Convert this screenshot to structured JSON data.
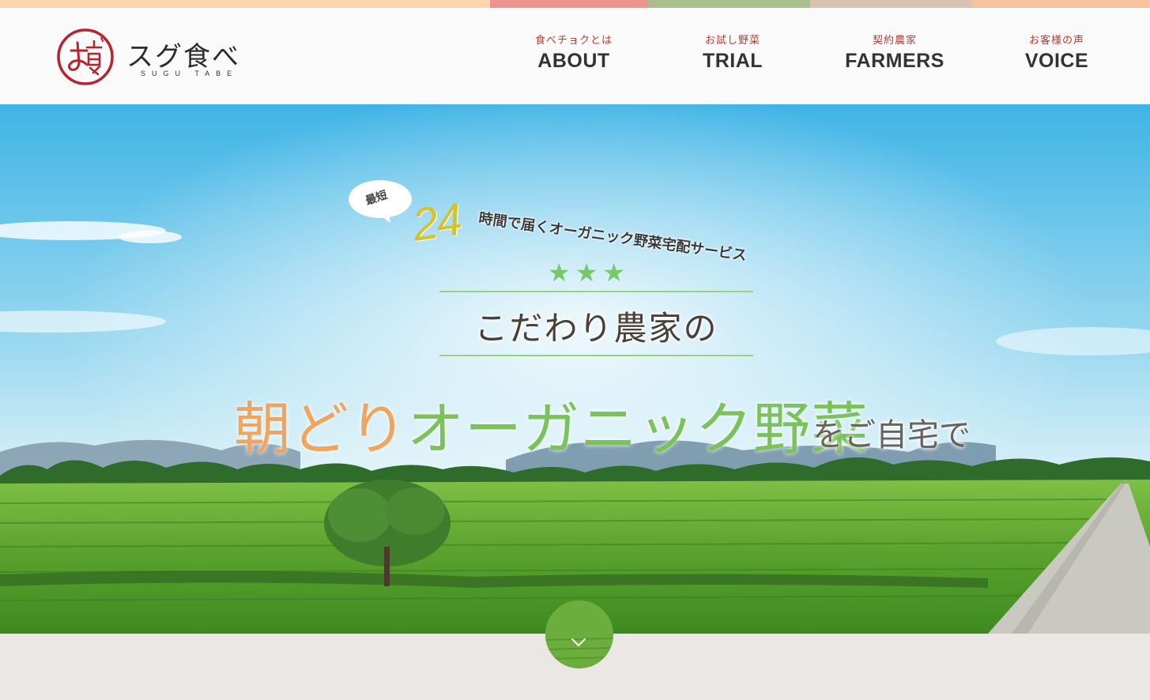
{
  "strip": {
    "colors": [
      "#fbd6b0",
      "#ec9490",
      "#a8c08e",
      "#d9c3b0",
      "#f5c49e"
    ]
  },
  "header": {
    "logo": {
      "name": "スグ食べ",
      "sub": "SUGU TABE"
    },
    "nav": [
      {
        "jp": "食べチョクとは",
        "en": "ABOUT"
      },
      {
        "jp": "お試し野菜",
        "en": "TRIAL"
      },
      {
        "jp": "契約農家",
        "en": "FARMERS"
      },
      {
        "jp": "お客様の声",
        "en": "VOICE"
      }
    ]
  },
  "hero": {
    "bubble": "最短",
    "number": "24",
    "tagline": "時間で届くオーガニック野菜宅配サービス",
    "stars": "★★★",
    "subheading": "こだわり農家の",
    "headline_part1": "朝どり",
    "headline_part2": "オーガニック野菜",
    "headline_part3": "をご自宅で"
  },
  "icons": {
    "scroll": "chevron-down-icon",
    "logo": "logo-mark-icon"
  },
  "colors": {
    "nav_jp": "#c0392b",
    "star_green": "#76c96a",
    "headline_orange": "#f0a55e",
    "headline_green": "#7cc25a",
    "footer_bg": "#ebe7e4"
  }
}
